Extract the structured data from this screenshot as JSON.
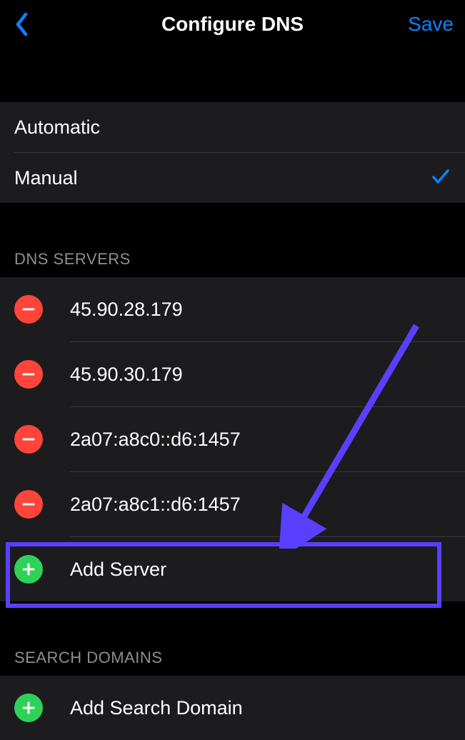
{
  "nav": {
    "title": "Configure DNS",
    "save_label": "Save"
  },
  "mode": {
    "automatic_label": "Automatic",
    "manual_label": "Manual"
  },
  "dns_section": {
    "header": "DNS SERVERS",
    "servers": [
      "45.90.28.179",
      "45.90.30.179",
      "2a07:a8c0::d6:1457",
      "2a07:a8c1::d6:1457"
    ],
    "add_label": "Add Server"
  },
  "search_section": {
    "header": "SEARCH DOMAINS",
    "add_label": "Add Search Domain"
  },
  "colors": {
    "accent": "#0a84ff",
    "remove": "#ff453a",
    "add": "#30d158",
    "annotation": "#5a3fff"
  }
}
